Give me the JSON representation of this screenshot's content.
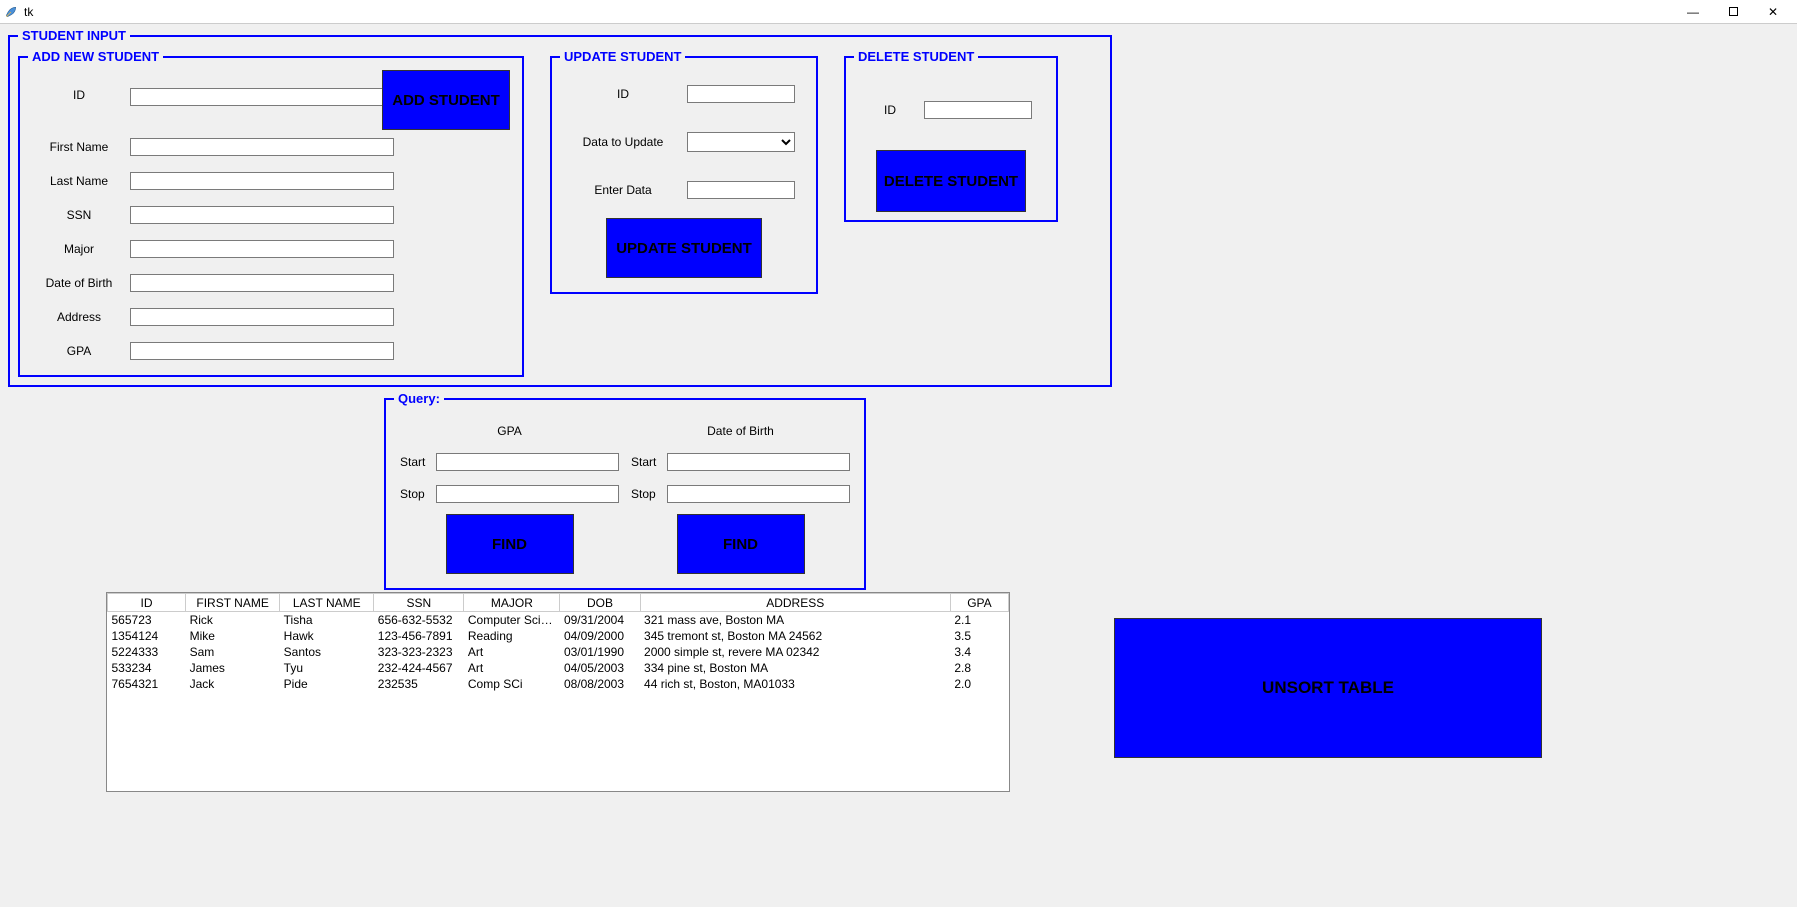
{
  "window": {
    "title": "tk"
  },
  "student_input": {
    "legend": "STUDENT INPUT",
    "add_new": {
      "legend": "ADD NEW STUDENT",
      "labels": {
        "id": "ID",
        "first_name": "First Name",
        "last_name": "Last Name",
        "ssn": "SSN",
        "major": "Major",
        "dob": "Date of Birth",
        "address": "Address",
        "gpa": "GPA"
      },
      "values": {
        "id": "",
        "first_name": "",
        "last_name": "",
        "ssn": "",
        "major": "",
        "dob": "",
        "address": "",
        "gpa": ""
      },
      "button": "ADD STUDENT"
    },
    "update": {
      "legend": "UPDATE STUDENT",
      "labels": {
        "id": "ID",
        "data_to_update": "Data to Update",
        "enter_data": "Enter Data"
      },
      "values": {
        "id": "",
        "data_to_update": "",
        "enter_data": ""
      },
      "button": "UPDATE STUDENT"
    },
    "delete": {
      "legend": "DELETE STUDENT",
      "labels": {
        "id": "ID"
      },
      "values": {
        "id": ""
      },
      "button": "DELETE STUDENT"
    }
  },
  "query": {
    "legend": "Query:",
    "gpa": {
      "head": "GPA",
      "start_label": "Start",
      "stop_label": "Stop",
      "start": "",
      "stop": "",
      "button": "FIND"
    },
    "dob": {
      "head": "Date of Birth",
      "start_label": "Start",
      "stop_label": "Stop",
      "start": "",
      "stop": "",
      "button": "FIND"
    }
  },
  "table": {
    "columns": [
      "ID",
      "FIRST NAME",
      "LAST NAME",
      "SSN",
      "MAJOR",
      "DOB",
      "ADDRESS",
      "GPA"
    ],
    "rows": [
      {
        "id": "565723",
        "first": "Rick",
        "last": "Tisha",
        "ssn": "656-632-5532",
        "major": "Computer Science",
        "dob": "09/31/2004",
        "address": "321 mass ave, Boston MA",
        "gpa": "2.1"
      },
      {
        "id": "1354124",
        "first": "Mike",
        "last": "Hawk",
        "ssn": "123-456-7891",
        "major": "Reading",
        "dob": "04/09/2000",
        "address": "345 tremont st, Boston MA 24562",
        "gpa": "3.5"
      },
      {
        "id": "5224333",
        "first": "Sam",
        "last": "Santos",
        "ssn": "323-323-2323",
        "major": "Art",
        "dob": "03/01/1990",
        "address": "2000 simple st, revere MA 02342",
        "gpa": "3.4"
      },
      {
        "id": "533234",
        "first": "James",
        "last": "Tyu",
        "ssn": "232-424-4567",
        "major": "Art",
        "dob": "04/05/2003",
        "address": "334 pine st, Boston MA",
        "gpa": "2.8"
      },
      {
        "id": "7654321",
        "first": "Jack",
        "last": "Pide",
        "ssn": "232535",
        "major": "Comp SCi",
        "dob": "08/08/2003",
        "address": "44 rich st, Boston, MA01033",
        "gpa": "2.0"
      }
    ]
  },
  "unsort_button": "UNSORT TABLE"
}
